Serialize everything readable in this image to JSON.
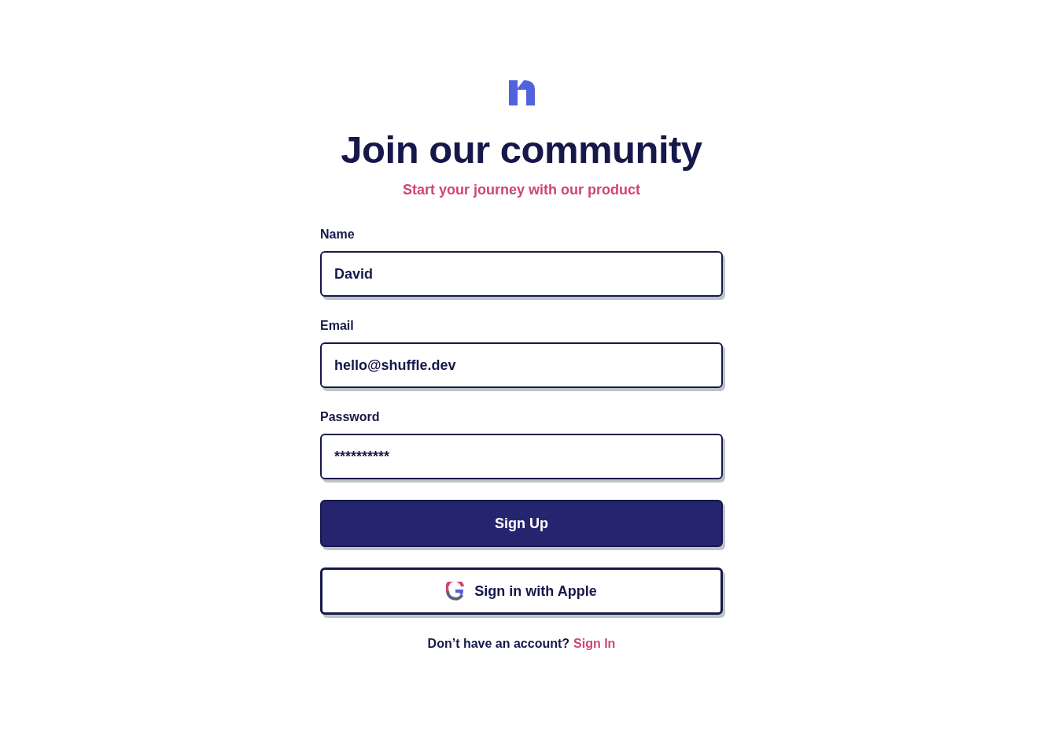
{
  "header": {
    "title": "Join our community",
    "subtitle": "Start your journey with our product"
  },
  "fields": [
    {
      "label": "Name",
      "value": "David"
    },
    {
      "label": "Email",
      "value": "hello@shuffle.dev"
    },
    {
      "label": "Password",
      "value": "**********"
    }
  ],
  "primary_button": {
    "label": "Sign Up"
  },
  "secondary_button": {
    "label": "Sign in with Apple"
  },
  "footer": {
    "text": "Don’t have an account?",
    "link": "Sign In"
  }
}
